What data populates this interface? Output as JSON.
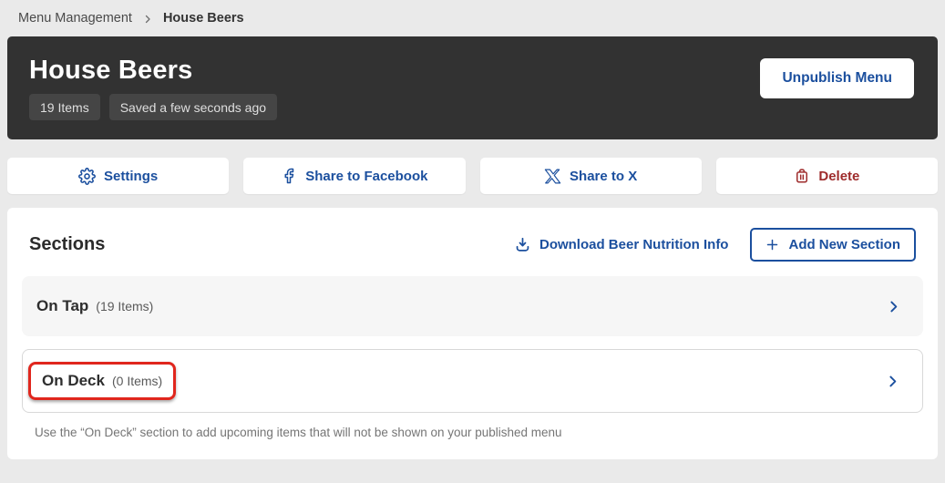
{
  "breadcrumb": {
    "items": [
      {
        "label": "Menu Management"
      },
      {
        "label": "House Beers"
      }
    ]
  },
  "header": {
    "title": "House Beers",
    "badges": [
      {
        "label": "19 Items"
      },
      {
        "label": "Saved a few seconds ago"
      }
    ],
    "unpublish_label": "Unpublish Menu"
  },
  "toolbar": {
    "buttons": [
      {
        "label": "Settings",
        "icon": "gear-icon"
      },
      {
        "label": "Share to Facebook",
        "icon": "facebook-icon"
      },
      {
        "label": "Share to X",
        "icon": "x-logo-icon"
      },
      {
        "label": "Delete",
        "icon": "trash-icon"
      }
    ]
  },
  "sections": {
    "heading": "Sections",
    "download_label": "Download Beer Nutrition Info",
    "add_label": "Add New Section",
    "rows": [
      {
        "name": "On Tap",
        "count": "(19 Items)",
        "highlighted": false
      },
      {
        "name": "On Deck",
        "count": "(0 Items)",
        "highlighted": true
      }
    ],
    "note": "Use the “On Deck” section to add upcoming items that will not be shown on your published menu"
  },
  "colors": {
    "accent_blue": "#1B4F9E",
    "delete_red": "#9E2B2B",
    "highlight_red": "#E0261D",
    "header_bg": "#323232",
    "page_bg": "#EAEAEA"
  }
}
